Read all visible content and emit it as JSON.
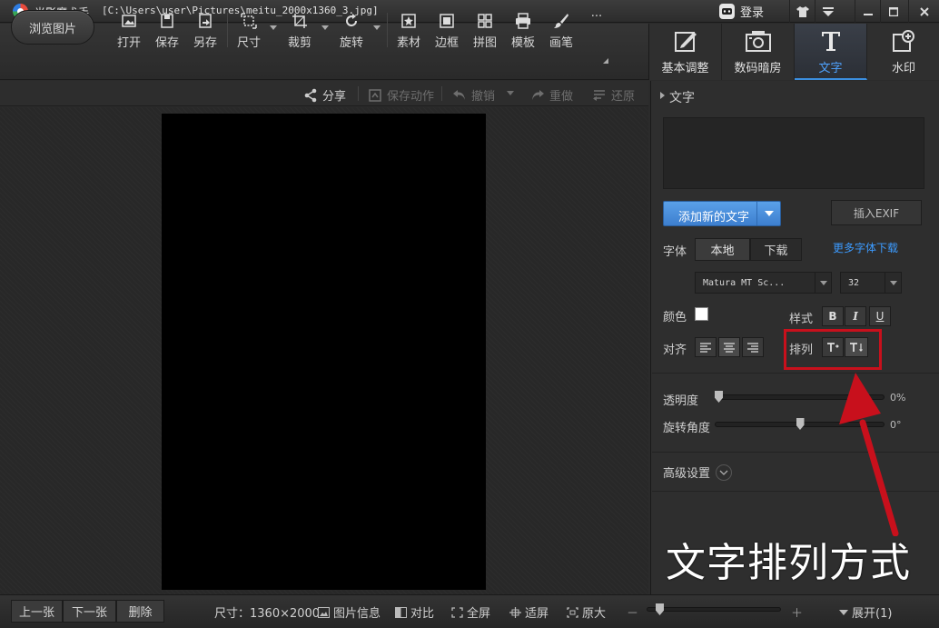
{
  "titlebar": {
    "app_title": "光影魔术手",
    "file_path": "[C:\\Users\\user\\Pictures\\meitu_2000x1360_3.jpg]",
    "login_label": "登录"
  },
  "toolbar": {
    "browse_label": "浏览图片",
    "tools": [
      {
        "label": "打开",
        "icon": "open-image-icon"
      },
      {
        "label": "保存",
        "icon": "save-icon"
      },
      {
        "label": "另存",
        "icon": "save-as-icon"
      },
      {
        "label": "尺寸",
        "icon": "resize-icon"
      },
      {
        "label": "裁剪",
        "icon": "crop-icon"
      },
      {
        "label": "旋转",
        "icon": "rotate-icon"
      },
      {
        "label": "素材",
        "icon": "material-icon"
      },
      {
        "label": "边框",
        "icon": "border-icon"
      },
      {
        "label": "拼图",
        "icon": "collage-icon"
      },
      {
        "label": "模板",
        "icon": "template-icon"
      },
      {
        "label": "画笔",
        "icon": "brush-icon"
      },
      {
        "label": "···",
        "icon": "more-icon"
      }
    ]
  },
  "tabs": [
    {
      "label": "基本调整",
      "icon": "basic-adjust-icon",
      "active": false
    },
    {
      "label": "数码暗房",
      "icon": "darkroom-icon",
      "active": false
    },
    {
      "label": "文字",
      "icon": "text-icon",
      "active": true
    },
    {
      "label": "水印",
      "icon": "watermark-icon",
      "active": false
    }
  ],
  "actions": {
    "share": "分享",
    "save_action": "保存动作",
    "undo": "撤销",
    "redo": "重做",
    "restore": "还原"
  },
  "panel": {
    "section_title": "文字",
    "add_text_label": "添加新的文字",
    "insert_exif_label": "插入EXIF",
    "font_label": "字体",
    "font_local": "本地",
    "font_download": "下载",
    "more_fonts_link": "更多字体下载",
    "font_name": "Matura MT Sc...",
    "font_size": "32",
    "color_label": "颜色",
    "color_value": "#ffffff",
    "style_label": "样式",
    "style_bold": "B",
    "style_italic": "I",
    "style_underline": "U",
    "align_label": "对齐",
    "arrange_label": "排列",
    "opacity_label": "透明度",
    "opacity_value": "0%",
    "opacity_fraction": 0,
    "rotation_label": "旋转角度",
    "rotation_value": "0°",
    "rotation_fraction": 0.5,
    "advanced_label": "高级设置"
  },
  "annotation": {
    "text": "文字排列方式",
    "color": "#c8101c"
  },
  "statusbar": {
    "prev": "上一张",
    "next": "下一张",
    "delete": "删除",
    "size_text": "尺寸：1360×2000",
    "image_info": "图片信息",
    "compare": "对比",
    "fullscreen": "全屏",
    "fit_screen": "适屏",
    "original_size": "原大",
    "zoom_minus": "－",
    "zoom_plus": "＋",
    "expand": "展开(1)"
  }
}
